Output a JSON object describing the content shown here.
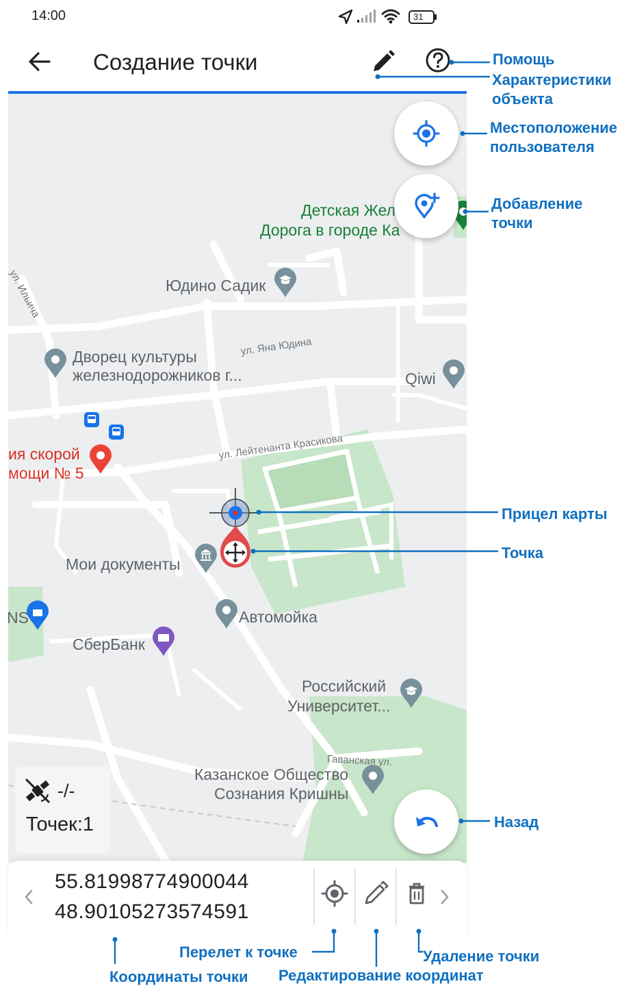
{
  "status_bar": {
    "time": "14:00",
    "battery": "31"
  },
  "app_bar": {
    "title": "Создание точки"
  },
  "map": {
    "places": {
      "railway": "Детская Жел",
      "railway_2": "Дорога в городе Ка",
      "kindergarten": "Юдино Садик",
      "palace": "Дворец культуры",
      "palace_2": "железнодорожников г...",
      "qiwi": "Qiwi",
      "ambulance": "ия скорой",
      "ambulance_2": "мощи № 5",
      "documents": "Мои документы",
      "carwash": "Автомойка",
      "ns": "NS",
      "sberbank": "СберБанк",
      "university": "Российский",
      "university_2": "Университет...",
      "krishna": "Казанское Общество",
      "krishna_2": "Сознания Кришны"
    },
    "streets": {
      "ilyicha": "ул. Ильича",
      "yana_yudina": "ул. Яна Юдина",
      "krasikova": "ул. Лейтенанта Красикова",
      "gavanskaya": "Гаванская ул."
    }
  },
  "gps": {
    "status": "-/-",
    "points_label": "Точек:1"
  },
  "coordinates": {
    "lat": "55.81998774900044",
    "lon": "48.90105273574591"
  },
  "annotations": {
    "help": "Помощь",
    "properties_1": "Характеристики",
    "properties_2": "объекта",
    "location_1": "Местоположение",
    "location_2": "пользователя",
    "add_point_1": "Добавление",
    "add_point_2": "точки",
    "crosshair": "Прицел карты",
    "point": "Точка",
    "back": "Назад",
    "fly_to_point": "Перелет к точке",
    "delete_point": "Удаление точки",
    "coordinates": "Координаты точки",
    "edit_coordinates": "Редактирование координат"
  },
  "colors": {
    "accent": "#1a73e8",
    "annotation": "#1070c0",
    "marker": "#e04b4b",
    "park": "#c8e6c9"
  },
  "icons": {
    "back": "arrow-left-icon",
    "edit": "pencil-icon",
    "help": "question-circle-icon",
    "location": "crosshair-gps-icon",
    "add_point": "map-marker-plus-icon",
    "undo": "undo-icon",
    "satellite": "satellite-off-icon",
    "fly": "gps-target-icon",
    "delete": "trash-icon"
  }
}
